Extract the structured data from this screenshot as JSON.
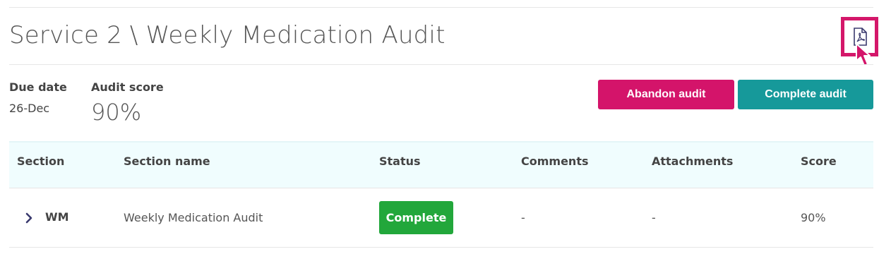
{
  "header": {
    "title": "Service 2 \\ Weekly Medication Audit",
    "pdf_icon": "pdf-document-icon"
  },
  "meta": {
    "due_date_label": "Due date",
    "due_date_value": "26-Dec",
    "audit_score_label": "Audit score",
    "audit_score_value": "90%"
  },
  "actions": {
    "abandon_label": "Abandon audit",
    "complete_label": "Complete audit"
  },
  "colors": {
    "accent_pink": "#d4146a",
    "accent_teal": "#16999a",
    "status_green": "#22a73b",
    "table_header_bg": "#f0fdfe"
  },
  "table": {
    "columns": [
      "Section",
      "Section name",
      "Status",
      "Comments",
      "Attachments",
      "Score"
    ],
    "rows": [
      {
        "section": "WM",
        "section_name": "Weekly Medication Audit",
        "status": "Complete",
        "comments": "-",
        "attachments": "-",
        "score": "90%"
      }
    ]
  }
}
